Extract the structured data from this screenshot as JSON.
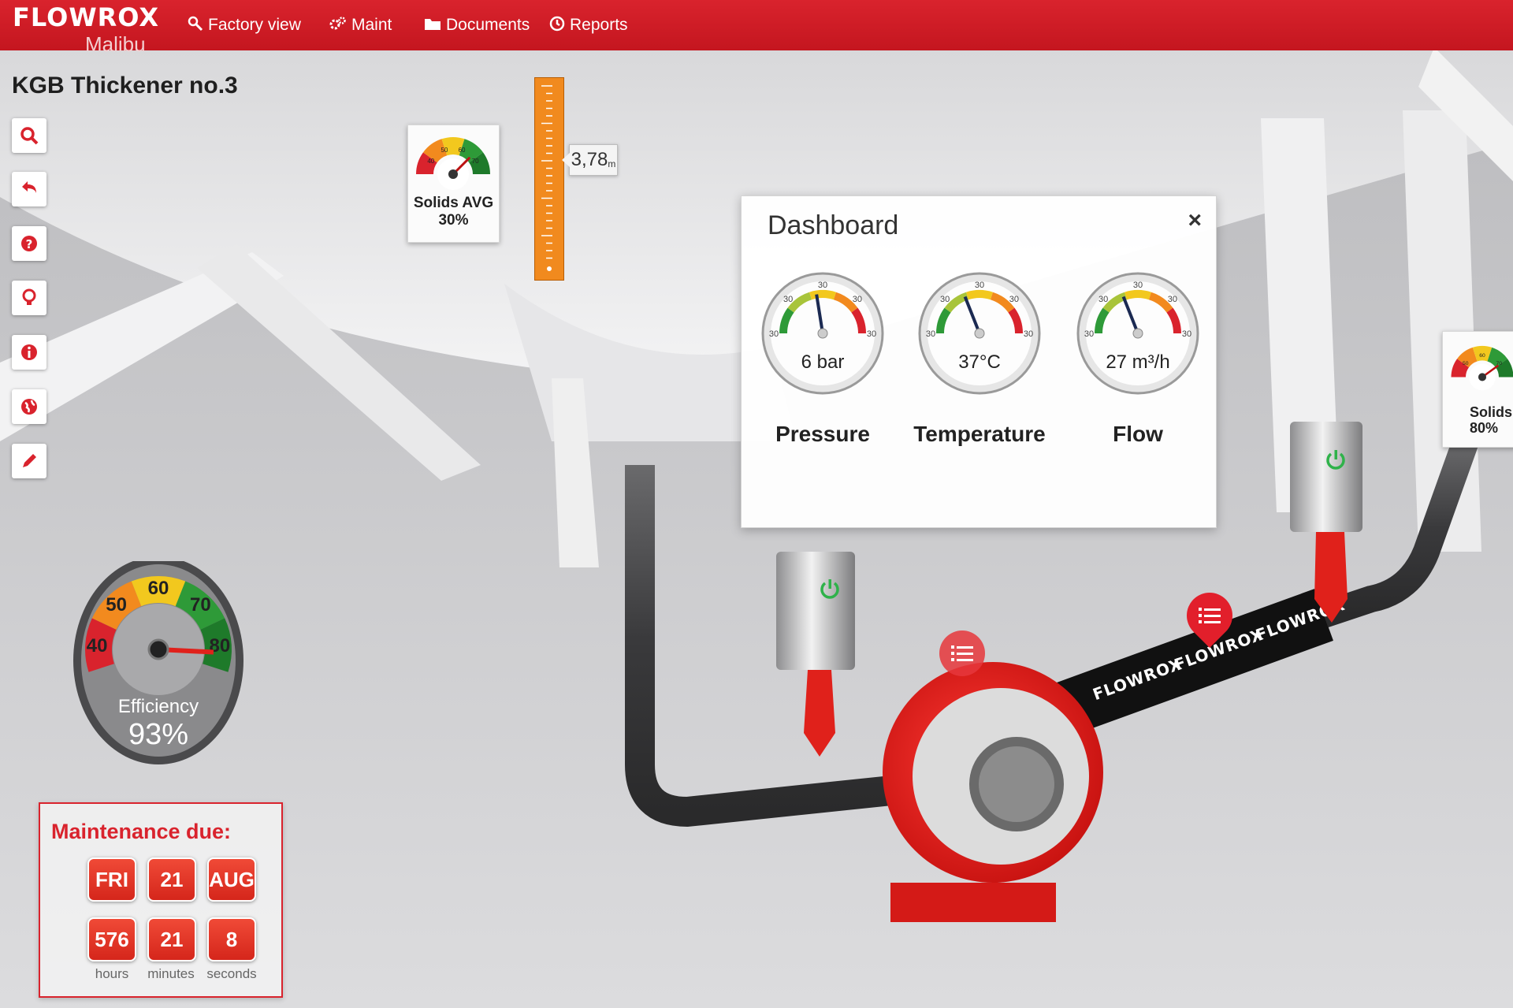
{
  "app": {
    "brand": "FLOWROX",
    "site": "Malibu"
  },
  "nav": [
    {
      "label": "Factory view",
      "icon": "search-wrench-icon"
    },
    {
      "label": "Maint",
      "icon": "cogs-icon"
    },
    {
      "label": "Documents",
      "icon": "folder-icon"
    },
    {
      "label": "Reports",
      "icon": "clock-icon"
    }
  ],
  "page": {
    "title": "KGB Thickener no.3"
  },
  "toolbar": [
    {
      "icon": "search-icon"
    },
    {
      "icon": "undo-icon"
    },
    {
      "icon": "help-icon"
    },
    {
      "icon": "lightbulb-icon"
    },
    {
      "icon": "info-icon"
    },
    {
      "icon": "globe-icon"
    },
    {
      "icon": "pencil-icon"
    }
  ],
  "solids_avg": {
    "label": "Solids AVG",
    "value": "30%",
    "ticks": [
      "40",
      "50",
      "60",
      "70"
    ],
    "level": 0.75
  },
  "solids_right": {
    "label": "Solids",
    "value": "80%",
    "ticks": [
      "50",
      "60",
      "70"
    ],
    "level": 0.8
  },
  "level_ruler": {
    "readout": "3,78",
    "unit": "m"
  },
  "dashboard": {
    "title": "Dashboard",
    "close": "×",
    "gauges": [
      {
        "name": "Pressure",
        "value": "6 bar",
        "ticks": [
          "30",
          "30",
          "30",
          "30",
          "30"
        ],
        "level": 0.45
      },
      {
        "name": "Temperature",
        "value": "37°C",
        "ticks": [
          "30",
          "30",
          "30",
          "30",
          "30"
        ],
        "level": 0.38
      },
      {
        "name": "Flow",
        "value": "27 m³/h",
        "ticks": [
          "30",
          "30",
          "30",
          "30",
          "30"
        ],
        "level": 0.38
      }
    ]
  },
  "efficiency": {
    "label": "Efficiency",
    "value": "93%",
    "ticks": [
      "40",
      "50",
      "60",
      "70",
      "80"
    ],
    "level": 0.93
  },
  "maintenance": {
    "title": "Maintenance due:",
    "day": "FRI",
    "date": "21",
    "month": "AUG",
    "hours": "576",
    "minutes": "21",
    "seconds": "8",
    "hours_label": "hours",
    "minutes_label": "minutes",
    "seconds_label": "seconds"
  },
  "pipe": {
    "brand_marks": [
      "FLOWROX",
      "FLOWROX",
      "FLOWROX"
    ]
  },
  "colors": {
    "brand_red": "#d9232d",
    "ruler_orange": "#f18a1e",
    "gauge_green": "#2e9a38",
    "gauge_yellow": "#f2c81e"
  }
}
